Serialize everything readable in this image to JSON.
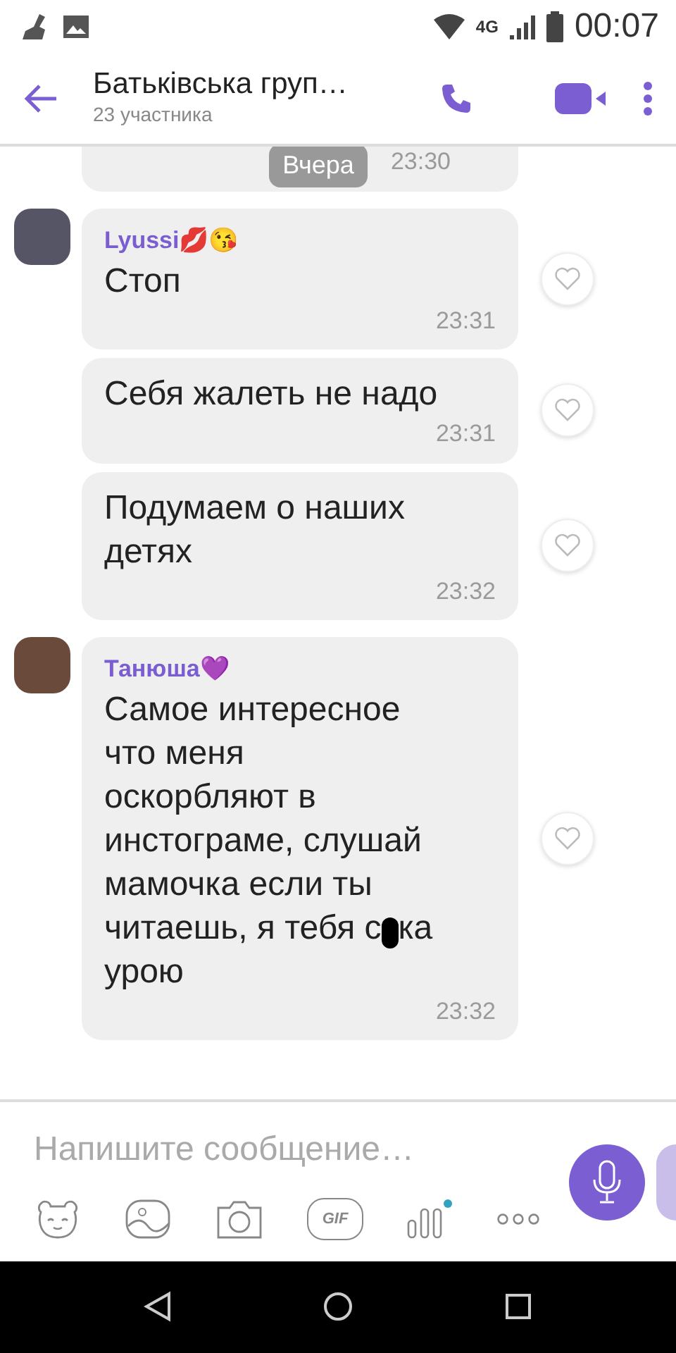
{
  "status_bar": {
    "network": "4G",
    "time": "00:07"
  },
  "header": {
    "title": "Батьківська груп…",
    "subtitle": "23 участника"
  },
  "previous": {
    "date_chip": "Вчера",
    "time": "23:30"
  },
  "messages": [
    {
      "sender": "Lyussi💋😘",
      "lines": [
        [
          {
            "kind": "text",
            "text": "Стоп"
          }
        ]
      ],
      "time": "23:31"
    },
    {
      "lines": [
        [
          {
            "kind": "text",
            "text": "Себя жалеть не надо"
          }
        ]
      ],
      "time": "23:31"
    },
    {
      "lines": [
        [
          {
            "kind": "text",
            "text": "Подумаем о наших"
          }
        ],
        [
          {
            "kind": "text",
            "text": "детях"
          }
        ]
      ],
      "time": "23:32"
    },
    {
      "sender": "Танюша💜",
      "lines": [
        [
          {
            "kind": "text",
            "text": "Самое интересное"
          }
        ],
        [
          {
            "kind": "text",
            "text": "что меня"
          }
        ],
        [
          {
            "kind": "text",
            "text": "оскорбляют в"
          }
        ],
        [
          {
            "kind": "text",
            "text": "инстограме, слушай"
          }
        ],
        [
          {
            "kind": "text",
            "text": "мамочка если ты"
          }
        ],
        [
          {
            "kind": "text",
            "text": "читаешь, я тебя с"
          },
          {
            "kind": "blot"
          },
          {
            "kind": "text",
            "text": "ка"
          }
        ],
        [
          {
            "kind": "text",
            "text": "урою"
          }
        ]
      ],
      "time": "23:32"
    }
  ],
  "composer": {
    "placeholder": "Напишите сообщение…",
    "gif_label": "GIF"
  }
}
